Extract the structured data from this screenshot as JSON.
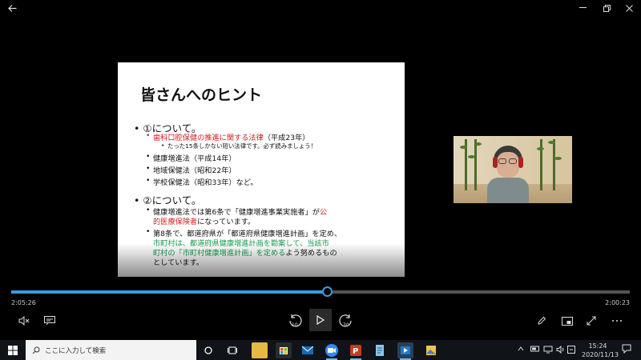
{
  "titlebar": {
    "back_icon": "back-arrow-icon",
    "minimize_icon": "minimize-icon",
    "restore_icon": "restore-icon",
    "close_icon": "close-icon"
  },
  "slide": {
    "title": "皆さんへのヒント",
    "items": [
      {
        "level": 1,
        "text": "①について。",
        "color": "#111111"
      },
      {
        "level": 2,
        "runs": [
          {
            "text": "歯科口腔保健の推進に関する法律",
            "color": "#d81b1b"
          },
          {
            "text": "（平成23年）",
            "color": "#111111"
          }
        ]
      },
      {
        "level": 3,
        "text": "たった15条しかない短い法律です。必ず読みましょう！",
        "color": "#111111"
      },
      {
        "level": 2,
        "text": "健康増進法（平成14年）",
        "color": "#111111"
      },
      {
        "level": 2,
        "text": "地域保健法（昭和22年）",
        "color": "#111111"
      },
      {
        "level": 2,
        "text": "学校保健法（昭和33年）など。",
        "color": "#111111"
      },
      {
        "level": 1,
        "text": "②について。",
        "color": "#111111"
      },
      {
        "level": 2,
        "runs": [
          {
            "text": "健康増進法では第6条で「健康増進事業実施者」が",
            "color": "#111111"
          },
          {
            "text": "公",
            "color": "#d81b1b"
          }
        ]
      },
      {
        "level": 2,
        "cont": true,
        "runs": [
          {
            "text": "的医療保険者",
            "color": "#d81b1b"
          },
          {
            "text": "になっています。",
            "color": "#111111"
          }
        ]
      },
      {
        "level": 2,
        "runs": [
          {
            "text": "第8条で、都道府県が「都道府県健康増進計画」を定め、",
            "color": "#111111"
          }
        ]
      },
      {
        "level": 2,
        "cont": true,
        "runs": [
          {
            "text": "市町村は、都道府県健康増進計画を勘案して、当該市",
            "color": "#1a9a52"
          }
        ]
      },
      {
        "level": 2,
        "cont": true,
        "runs": [
          {
            "text": "町村の「市町村健康増進計画」を定める",
            "color": "#1a9a52"
          },
          {
            "text": "よう努めるもの",
            "color": "#111111"
          }
        ]
      },
      {
        "level": 2,
        "cont": true,
        "runs": [
          {
            "text": "としています。",
            "color": "#111111"
          }
        ]
      }
    ]
  },
  "player": {
    "elapsed": "2:05:26",
    "remaining": "2:00:23",
    "progress_fraction": 0.5099,
    "accent": "#3d9ad9",
    "controls": {
      "mute_icon": "volume-mute-icon",
      "captions_icon": "captions-icon",
      "skip_back_label": "10",
      "skip_forward_label": "30",
      "play_icon": "play-icon",
      "edit_icon": "pen-icon",
      "miniview_icon": "mini-view-icon",
      "fullscreen_icon": "fullscreen-icon",
      "more_icon": "more-icon"
    }
  },
  "taskbar": {
    "search_placeholder": "ここに入力して検索",
    "time": "15:24",
    "date": "2020/11/13",
    "apps": [
      "file-explorer",
      "store",
      "mail",
      "zoom",
      "powerpoint",
      "notepad",
      "movies-tv",
      "photos"
    ]
  }
}
